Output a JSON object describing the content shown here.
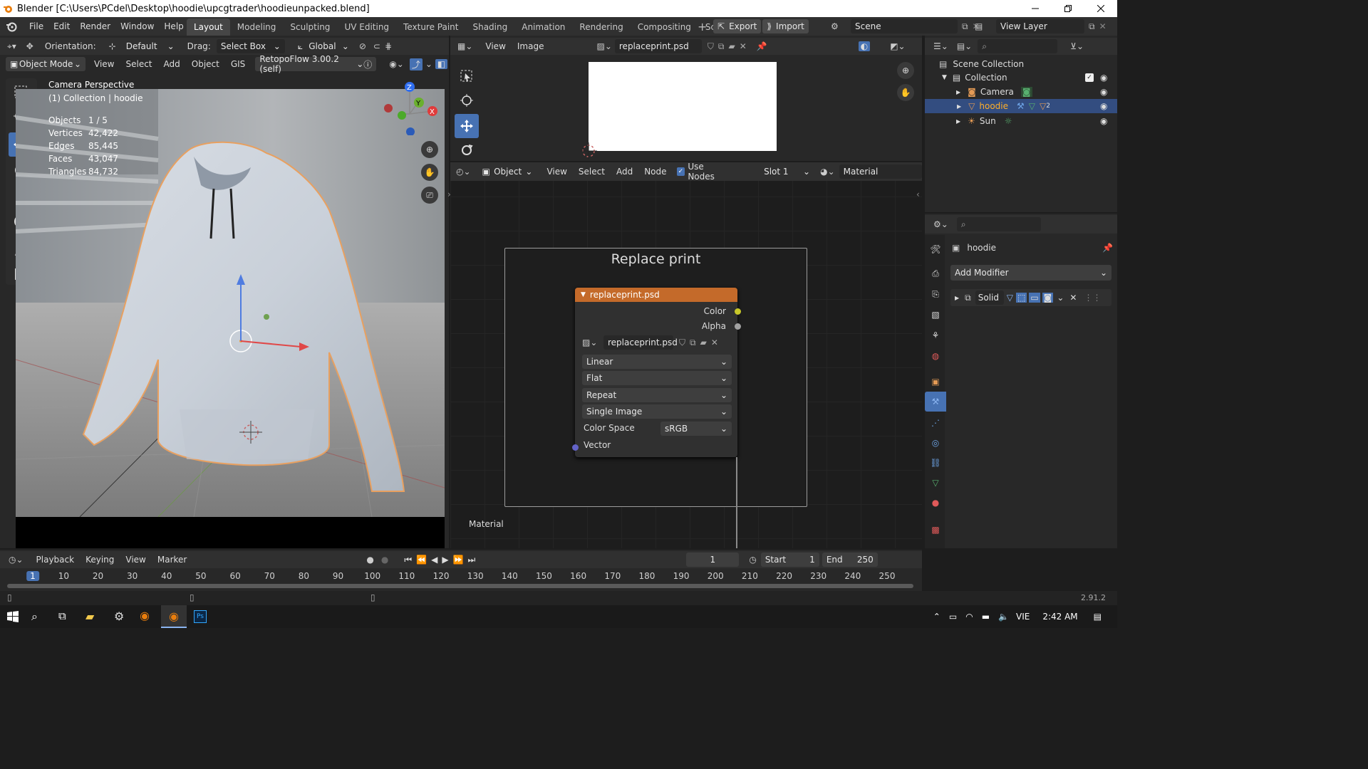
{
  "title_bar": {
    "title": "Blender [C:\\Users\\PCdel\\Desktop\\hoodie\\upcgtrader\\hoodieunpacked.blend]"
  },
  "menu": {
    "items": [
      "File",
      "Edit",
      "Render",
      "Window",
      "Help"
    ]
  },
  "workspaces": [
    "Layout",
    "Modeling",
    "Sculpting",
    "UV Editing",
    "Texture Paint",
    "Shading",
    "Animation",
    "Rendering",
    "Compositing",
    "Scripting"
  ],
  "active_workspace": "Layout",
  "rp_buttons": {
    "export": "Export",
    "import": "Import"
  },
  "scene": {
    "name": "Scene"
  },
  "view_layer": {
    "name": "View Layer"
  },
  "viewport": {
    "header": {
      "orientation_label": "Orientation:",
      "orientation_value": "Default",
      "drag_label": "Drag:",
      "drag_value": "Select Box",
      "transform_space": "Global"
    },
    "mode": "Object Mode",
    "menu": [
      "View",
      "Select",
      "Add",
      "Object",
      "GIS"
    ],
    "addon": "RetopoFlow 3.00.2 (self)",
    "overlay_title": "Camera Perspective",
    "overlay_sub": "(1) Collection | hoodie",
    "stats": [
      {
        "label": "Objects",
        "value": "1 / 5"
      },
      {
        "label": "Vertices",
        "value": "42,422"
      },
      {
        "label": "Edges",
        "value": "85,445"
      },
      {
        "label": "Faces",
        "value": "43,047"
      },
      {
        "label": "Triangles",
        "value": "84,732"
      }
    ],
    "gizmo_labels": {
      "z": "Z",
      "y": "Y",
      "x": "X"
    }
  },
  "image_editor": {
    "menu": [
      "View",
      "Image"
    ],
    "image_name": "replaceprint.psd"
  },
  "node_editor": {
    "object_type": "Object",
    "menu": [
      "View",
      "Select",
      "Add",
      "Node"
    ],
    "use_nodes_label": "Use Nodes",
    "slot": "Slot 1",
    "material": "Material",
    "frame_title": "Replace print",
    "footer_label": "Material",
    "node": {
      "title": "replaceprint.psd",
      "outputs": [
        "Color",
        "Alpha"
      ],
      "image_name": "replaceprint.psd",
      "interpolation": "Linear",
      "projection": "Flat",
      "extension": "Repeat",
      "source": "Single Image",
      "colorspace_label": "Color Space",
      "colorspace_value": "sRGB",
      "input": "Vector"
    },
    "colors": {
      "header": "#c46a2a",
      "color_socket": "#c7c729",
      "alpha_socket": "#a1a1a1",
      "vector_socket": "#6363c7"
    }
  },
  "outliner": {
    "scene_collection": "Scene Collection",
    "collection": "Collection",
    "items": [
      "Camera",
      "hoodie",
      "Sun"
    ],
    "selected": "hoodie",
    "modifier_count": "2"
  },
  "properties": {
    "object_name": "hoodie",
    "add_modifier": "Add Modifier",
    "modifier_name": "Solid"
  },
  "timeline": {
    "menu": [
      "Playback",
      "Keying",
      "View",
      "Marker"
    ],
    "current_frame": "1",
    "start_label": "Start",
    "start": "1",
    "end_label": "End",
    "end": "250",
    "ruler": [
      "1",
      "10",
      "20",
      "30",
      "40",
      "50",
      "60",
      "70",
      "80",
      "90",
      "100",
      "110",
      "120",
      "130",
      "140",
      "150",
      "160",
      "170",
      "180",
      "190",
      "200",
      "210",
      "220",
      "230",
      "240",
      "250"
    ]
  },
  "status": {
    "version": "2.91.2"
  },
  "taskbar": {
    "lang": "VIE",
    "time": "2:42 AM"
  }
}
